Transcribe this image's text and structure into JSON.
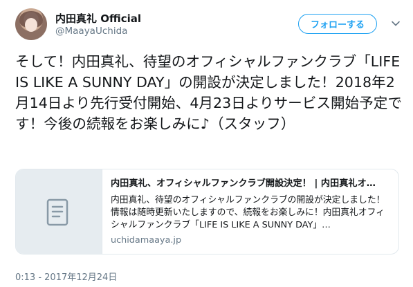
{
  "author": {
    "name": "内田真礼 Official",
    "handle": "@MaayaUchida"
  },
  "follow_button": {
    "label": "フォローする"
  },
  "tweet": {
    "text": "そして！内田真礼、待望のオフィシャルファンクラブ「LIFE IS LIKE A SUNNY DAY」の開設が決定しました！2018年2月14日より先行受付開始、4月23日よりサービス開始予定です！今後の続報をお楽しみに♪（スタッフ）"
  },
  "card": {
    "title": "内田真礼、オフィシャルファンクラブ開設決定！ | 内田真礼オ…",
    "description": "内田真礼、待望のオフィシャルファンクラブの開設が決定しました！情報は随時更新いたしますので、続報をお楽しみに！内田真礼オフィシャルファンクラブ「LIFE IS LIKE A SUNNY DAY」…",
    "domain": "uchidamaaya.jp",
    "thumbnail_icon": "document-icon"
  },
  "timestamp": "0:13 - 2017年12月24日",
  "colors": {
    "accent": "#1da1f2",
    "muted_text": "#657786",
    "border": "#e1e8ed",
    "thumb_bg": "#e6ecf0"
  }
}
